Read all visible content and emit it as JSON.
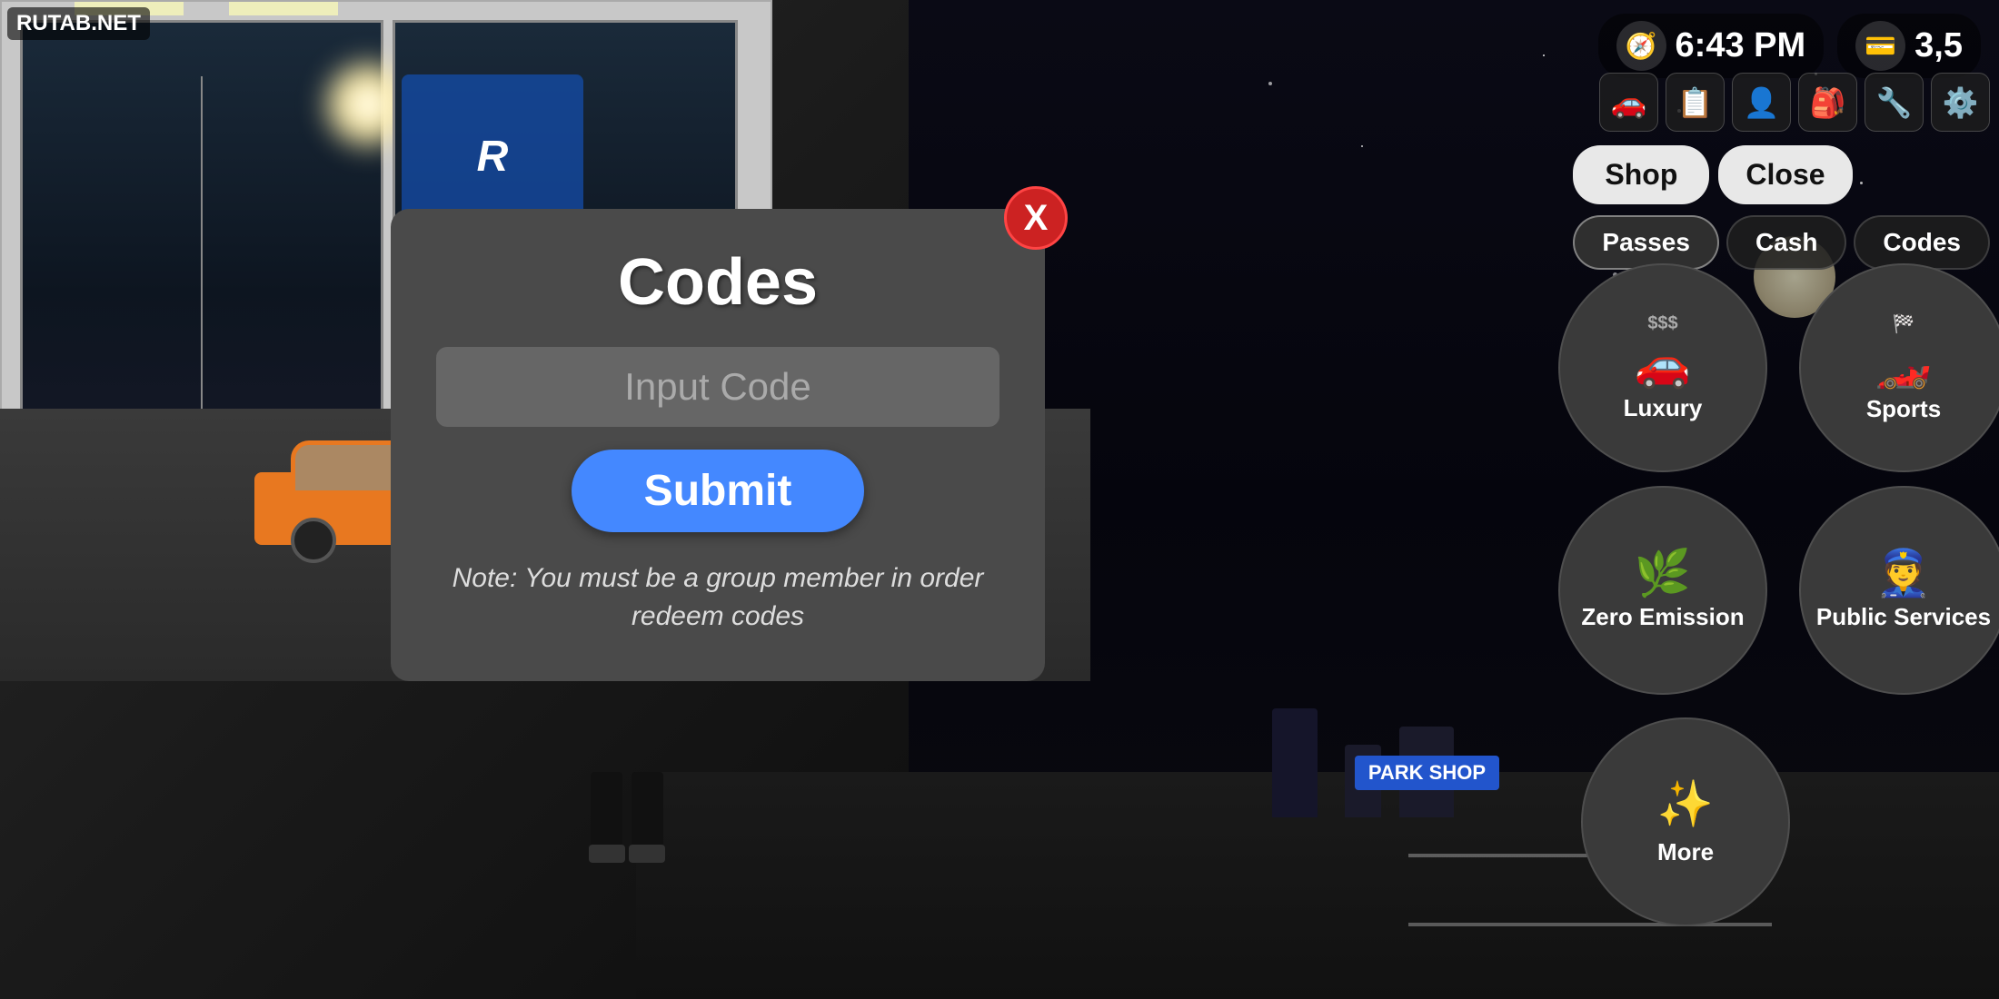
{
  "site": {
    "label": "RUTAB.NET"
  },
  "hud": {
    "time": "6:43 PM",
    "money": "3,5",
    "time_icon": "🕐",
    "wallet_icon": "💳",
    "car_icon": "🚗",
    "list_icon": "📋",
    "person_icon": "👤",
    "bag_icon": "🎒",
    "wrench_icon": "🔧",
    "settings_icon": "⚙️"
  },
  "shop": {
    "shop_label": "Shop",
    "close_label": "Close",
    "tabs": [
      {
        "label": "Passes",
        "active": true
      },
      {
        "label": "Cash",
        "active": false
      },
      {
        "label": "Codes",
        "active": false
      }
    ]
  },
  "vehicle_categories": [
    {
      "name": "Luxury",
      "icon": "🚗",
      "price_label": "$$$"
    },
    {
      "name": "Sports",
      "icon": "🏎️",
      "price_label": "🏁"
    },
    {
      "name": "Zero Emission",
      "icon": "🌿",
      "price_label": ""
    },
    {
      "name": "Public Services",
      "icon": "👮",
      "price_label": ""
    },
    {
      "name": "More",
      "icon": "✨",
      "price_label": ""
    }
  ],
  "codes_modal": {
    "title": "Codes",
    "input_placeholder": "Input Code",
    "submit_label": "Submit",
    "note": "Note: You must be a group\nmember in order redeem codes",
    "close_icon": "X"
  }
}
